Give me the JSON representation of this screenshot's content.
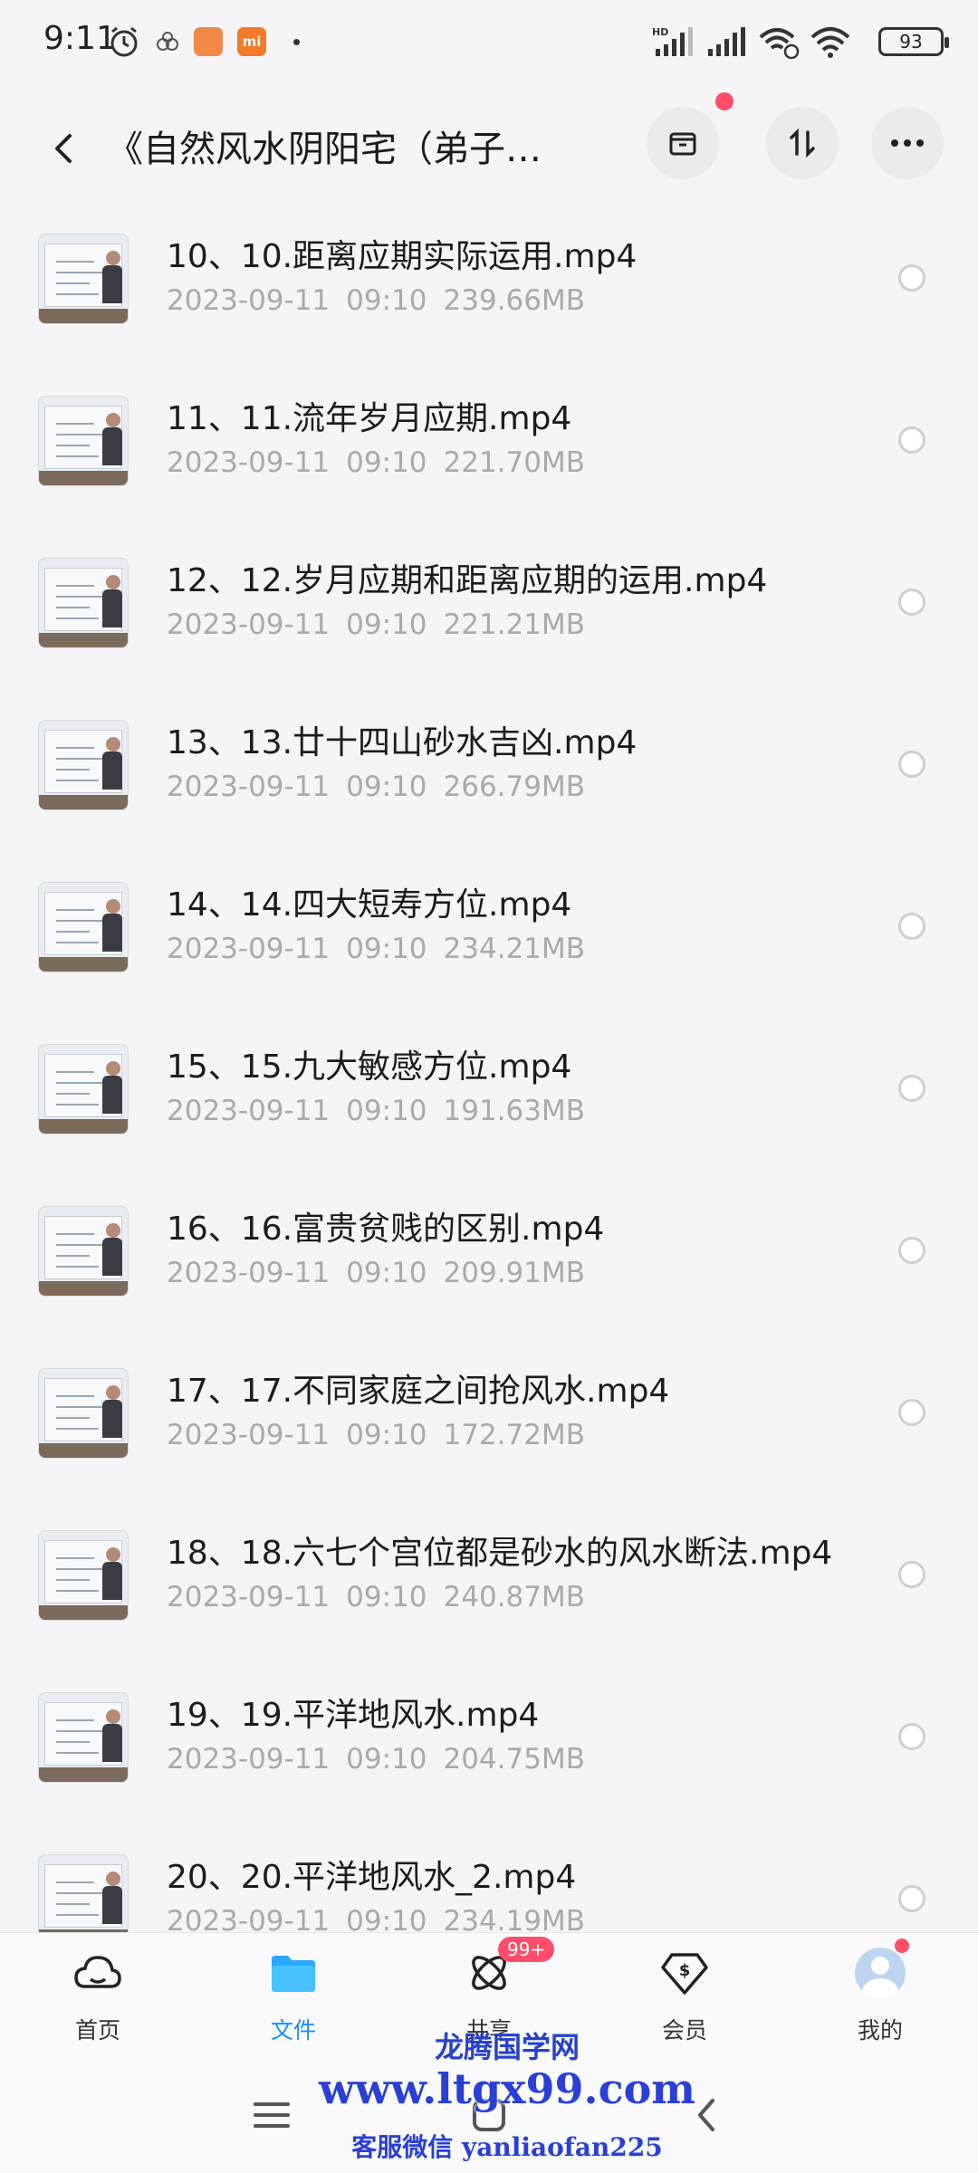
{
  "status_bar": {
    "time": "9:11",
    "battery": "93",
    "icons": [
      "alarm-icon",
      "weibo-icon",
      "orange-app-icon",
      "mi-store-icon",
      "dot-icon",
      "hd-signal-icon",
      "signal-icon",
      "wifi-call-icon",
      "wifi-icon",
      "battery-icon"
    ]
  },
  "header": {
    "title": "《自然风水阴阳宅（弟子…",
    "buttons": [
      "back-icon",
      "archive-icon",
      "sort-icon",
      "more-icon"
    ]
  },
  "files": [
    {
      "name": "10、10.距离应期实际运用.mp4",
      "date": "2023-09-11",
      "time": "09:10",
      "size": "239.66MB"
    },
    {
      "name": "11、11.流年岁月应期.mp4",
      "date": "2023-09-11",
      "time": "09:10",
      "size": "221.70MB"
    },
    {
      "name": "12、12.岁月应期和距离应期的运用.mp4",
      "date": "2023-09-11",
      "time": "09:10",
      "size": "221.21MB"
    },
    {
      "name": "13、13.廿十四山砂水吉凶.mp4",
      "date": "2023-09-11",
      "time": "09:10",
      "size": "266.79MB"
    },
    {
      "name": "14、14.四大短寿方位.mp4",
      "date": "2023-09-11",
      "time": "09:10",
      "size": "234.21MB"
    },
    {
      "name": "15、15.九大敏感方位.mp4",
      "date": "2023-09-11",
      "time": "09:10",
      "size": "191.63MB"
    },
    {
      "name": "16、16.富贵贫贱的区别.mp4",
      "date": "2023-09-11",
      "time": "09:10",
      "size": "209.91MB"
    },
    {
      "name": "17、17.不同家庭之间抢风水.mp4",
      "date": "2023-09-11",
      "time": "09:10",
      "size": "172.72MB"
    },
    {
      "name": "18、18.六七个宫位都是砂水的风水断法.mp4",
      "date": "2023-09-11",
      "time": "09:10",
      "size": "240.87MB"
    },
    {
      "name": "19、19.平洋地风水.mp4",
      "date": "2023-09-11",
      "time": "09:10",
      "size": "204.75MB"
    },
    {
      "name": "20、20.平洋地风水_2.mp4",
      "date": "2023-09-11",
      "time": "09:10",
      "size": "234.19MB"
    }
  ],
  "tabs": [
    {
      "label": "首页",
      "icon": "cloud-home-icon"
    },
    {
      "label": "文件",
      "icon": "folder-icon",
      "active": true
    },
    {
      "label": "共享",
      "icon": "share-atom-icon",
      "badge": "99+"
    },
    {
      "label": "会员",
      "icon": "vip-diamond-icon"
    },
    {
      "label": "我的",
      "icon": "avatar-icon"
    }
  ],
  "nav": [
    "menu-icon",
    "home-icon",
    "back-icon"
  ],
  "watermark": {
    "line1": "龙腾国学网",
    "line2": "www.ltgx99.com",
    "line3": "客服微信 yanliaofan225"
  },
  "colors": {
    "accent": "#1a8cff",
    "badge": "#ff4d6a",
    "meta_text": "#a9a9ae",
    "watermark": "#2a3fd6"
  }
}
